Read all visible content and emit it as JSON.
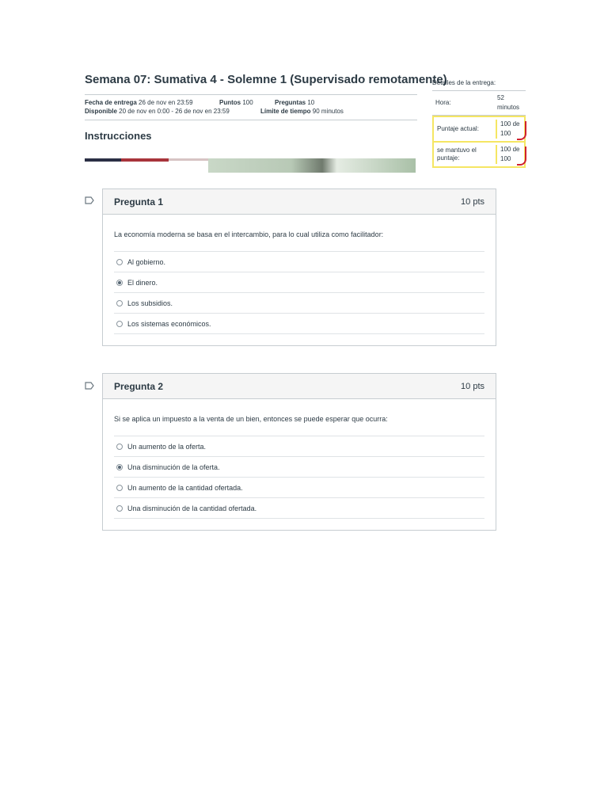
{
  "quiz": {
    "title": "Semana 07: Sumativa 4 - Solemne 1 (Supervisado remotamente)",
    "due_label": "Fecha de entrega",
    "due_value": "26 de nov en 23:59",
    "points_label": "Puntos",
    "points_value": "100",
    "questions_label": "Preguntas",
    "questions_value": "10",
    "available_label": "Disponible",
    "available_value": "20 de nov en 0:00 - 26 de nov en 23:59",
    "time_limit_label": "Límite de tiempo",
    "time_limit_value": "90 minutos",
    "instructions_title": "Instrucciones"
  },
  "details": {
    "title": "Detalles de la entrega:",
    "hora_label": "Hora:",
    "hora_value": "52 minutos",
    "score_label": "Puntaje actual:",
    "score_value": "100 de 100",
    "kept_label": "se mantuvo el puntaje:",
    "kept_value": "100 de 100",
    "highlight_color": "#f5e663",
    "mark_color": "#d0212f"
  },
  "questions": [
    {
      "title": "Pregunta 1",
      "points": "10 pts",
      "text": "La economía moderna se basa en el intercambio, para lo cual utiliza como facilitador:",
      "answers": [
        "Al gobierno.",
        "El dinero.",
        "Los subsidios.",
        "Los sistemas económicos."
      ],
      "selected_index": 1
    },
    {
      "title": "Pregunta 2",
      "points": "10 pts",
      "text": "Si se aplica un impuesto a la venta de un bien, entonces se puede esperar que ocurra:",
      "answers": [
        "Un aumento de la oferta.",
        "Una disminución de la oferta.",
        "Un aumento de la cantidad ofertada.",
        "Una disminución de la cantidad ofertada."
      ],
      "selected_index": 1
    }
  ],
  "icons": {
    "question_flag": "flag-outline-icon",
    "radio": "radio-button-icon"
  }
}
